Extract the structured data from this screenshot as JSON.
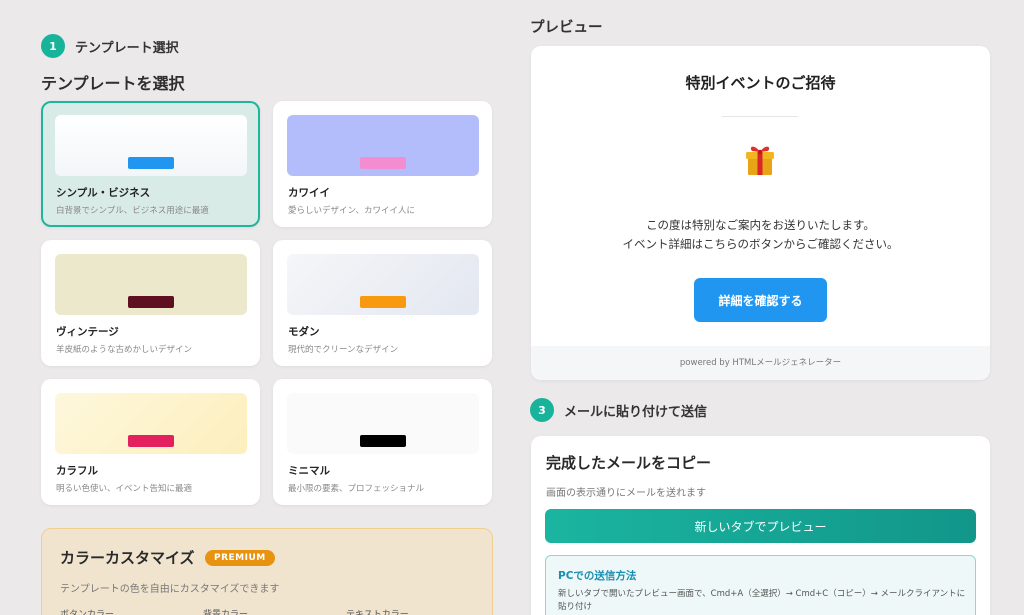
{
  "step1": {
    "number": "1",
    "label": "テンプレート選択"
  },
  "template_section": {
    "title": "テンプレートを選択"
  },
  "templates": [
    {
      "name": "シンプル・ビジネス",
      "desc": "白背景でシンプル、ビジネス用途に最適",
      "bar_color": "#2196f0",
      "preview_bg": "#ffffff",
      "selected": true
    },
    {
      "name": "カワイイ",
      "desc": "愛らしいデザイン、カワイイ人に",
      "bar_color": "#f28ecf",
      "preview_bg": "#b4bdfb",
      "selected": false
    },
    {
      "name": "ヴィンテージ",
      "desc": "羊皮紙のような古めかしいデザイン",
      "bar_color": "#5e1020",
      "preview_bg": "#ebe8cc",
      "selected": false
    },
    {
      "name": "モダン",
      "desc": "現代的でクリーンなデザイン",
      "bar_color": "#f99910",
      "preview_bg": "#eef0f6",
      "selected": false
    },
    {
      "name": "カラフル",
      "desc": "明るい色使い、イベント告知に最適",
      "bar_color": "#e3215f",
      "preview_bg": "#fdf4d6",
      "selected": false
    },
    {
      "name": "ミニマル",
      "desc": "最小限の要素、プロフェッショナル",
      "bar_color": "#000000",
      "preview_bg": "#fafafa",
      "selected": false
    }
  ],
  "premium": {
    "title": "カラーカスタマイズ",
    "badge": "PREMIUM",
    "desc": "テンプレートの色を自由にカスタマイズできます",
    "columns": [
      "ボタンカラー",
      "背景カラー",
      "テキストカラー"
    ]
  },
  "preview": {
    "heading": "プレビュー",
    "title": "特別イベントのご招待",
    "body_lines": [
      "この度は特別なご案内をお送りいたします。",
      "イベント詳細はこちらのボタンからご確認ください。"
    ],
    "button_label": "詳細を確認する",
    "footer": "powered by HTMLメールジェネレーター",
    "icon": "gift-icon"
  },
  "step3": {
    "number": "3",
    "label": "メールに貼り付けて送信"
  },
  "copy": {
    "title": "完成したメールをコピー",
    "subtitle": "画面の表示通りにメールを送れます",
    "button_label": "新しいタブでプレビュー",
    "howto_title": "PCでの送信方法",
    "howto_text": "新しいタブで開いたプレビュー画面で、Cmd+A（全選択）→ Cmd+C（コピー）→ メールクライアントに貼り付け"
  },
  "colors": {
    "accent": "#17b39a",
    "preview_button": "#2196f0",
    "premium_badge": "#e8930f"
  }
}
